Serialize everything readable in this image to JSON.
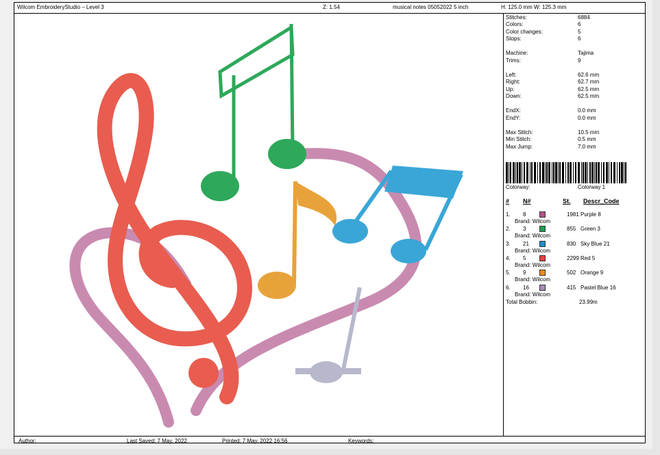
{
  "header": {
    "app_title": "Wilcom EmbroideryStudio – Level 3",
    "zoom": "Z: 1.54",
    "design_name": "musical notes 05052022 5 inch",
    "dimensions": "H: 125.0 mm   W: 125.3 mm"
  },
  "stats": [
    {
      "label": "Stitches:",
      "value": "6884"
    },
    {
      "label": "Colors:",
      "value": "6"
    },
    {
      "label": "Color changes:",
      "value": "5"
    },
    {
      "label": "Stops:",
      "value": "6"
    },
    {
      "label": "Machine:",
      "value": "Tajima"
    },
    {
      "label": "Trims:",
      "value": "9"
    },
    {
      "label": "Left:",
      "value": "62.6 mm"
    },
    {
      "label": "Right:",
      "value": "62.7 mm"
    },
    {
      "label": "Up:",
      "value": "62.5 mm"
    },
    {
      "label": "Down:",
      "value": "62.5 mm"
    },
    {
      "label": "EndX:",
      "value": "0.0 mm"
    },
    {
      "label": "EndY:",
      "value": "0.0 mm"
    },
    {
      "label": "Max Stitch:",
      "value": "10.5 mm"
    },
    {
      "label": "Min Stitch:",
      "value": "0.5 mm"
    },
    {
      "label": "Max Jump:",
      "value": "7.0 mm"
    }
  ],
  "colorway": {
    "label": "Colorway:",
    "value": "Colorway 1"
  },
  "table": {
    "headers": {
      "idx": "#",
      "num": "N#",
      "st": "St.",
      "desc": "Descr_Code"
    },
    "rows": [
      {
        "idx": "1.",
        "num": "8",
        "color": "#b0508a",
        "st": "1981",
        "desc": "Purple 8",
        "brand": "Brand: Wilcom"
      },
      {
        "idx": "2.",
        "num": "3",
        "color": "#1e9e50",
        "st": "855",
        "desc": "Green 3",
        "brand": "Brand: Wilcom"
      },
      {
        "idx": "3.",
        "num": "21",
        "color": "#1f8ed0",
        "st": "830",
        "desc": "Sky Blue 21",
        "brand": "Brand: Wilcom"
      },
      {
        "idx": "4.",
        "num": "5",
        "color": "#e8403c",
        "st": "2299",
        "desc": "Red 5",
        "brand": "Brand: Wilcom"
      },
      {
        "idx": "5.",
        "num": "9",
        "color": "#f08a1c",
        "st": "502",
        "desc": "Orange 9",
        "brand": "Brand: Wilcom"
      },
      {
        "idx": "6.",
        "num": "16",
        "color": "#a88ab8",
        "st": "415",
        "desc": "Pastel Blue 16",
        "brand": "Brand: Wilcom"
      }
    ],
    "total_label": "Total Bobbin:",
    "total_value": "23.99m"
  },
  "footer": {
    "author": "Author:",
    "last_saved": "Last Saved:  7 May, 2022",
    "printed": "Printed:  7 May, 2022 16:56",
    "keywords": "Keywords:"
  },
  "design_colors": {
    "heart": "#c98ab0",
    "treble_clef": "#e85d4f",
    "green_note": "#2ea85a",
    "orange_note": "#e8a23a",
    "blue_note": "#3aa6d6",
    "grey_note": "#b8b8cc"
  }
}
